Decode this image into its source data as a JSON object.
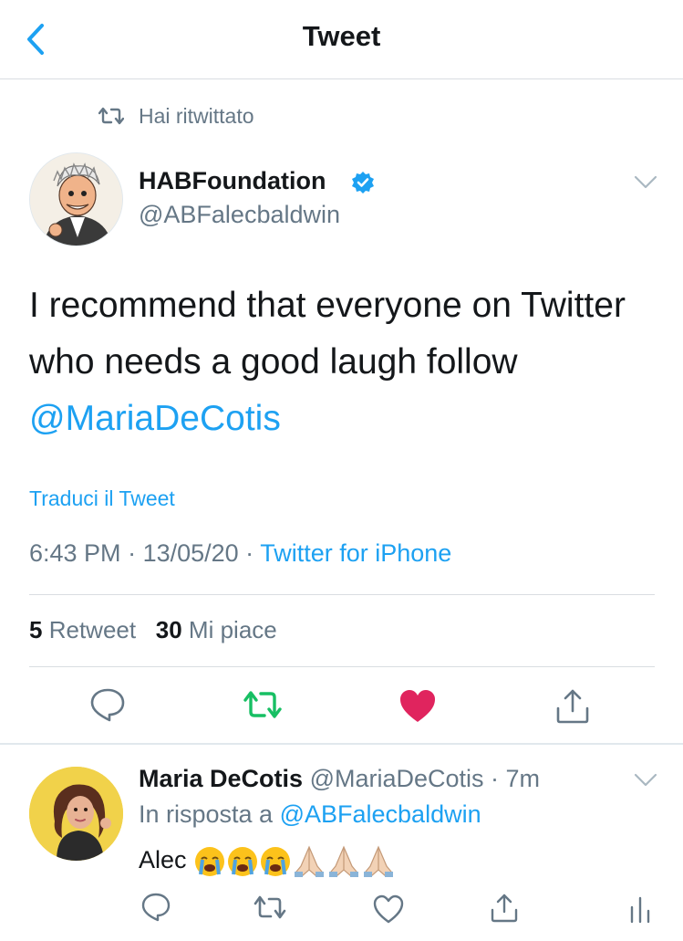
{
  "header": {
    "title": "Tweet",
    "back_icon": "chevron-left-icon"
  },
  "context": {
    "label": "Hai ritwittato",
    "icon": "retweet-icon"
  },
  "tweet": {
    "author_name": "HABFoundation",
    "verified": true,
    "handle": "@ABFalecbaldwin",
    "text_before": "I recommend that everyone on Twitter who needs a good laugh follow ",
    "mention": "@MariaDeCotis",
    "translate_label": "Traduci il Tweet",
    "time": "6:43 PM",
    "date": "13/05/20",
    "source": "Twitter for iPhone",
    "retweets_count": "5",
    "retweets_label": "Retweet",
    "likes_count": "30",
    "likes_label": "Mi piace",
    "liked": true,
    "retweeted": true
  },
  "reply": {
    "author_name": "Maria DeCotis",
    "handle": "@MariaDeCotis",
    "time": "7m",
    "reply_prefix": "In risposta a",
    "reply_to": "@ABFalecbaldwin",
    "text": "Alec",
    "emojis": [
      "loudly-crying-face",
      "loudly-crying-face",
      "loudly-crying-face",
      "folded-hands",
      "folded-hands",
      "folded-hands"
    ]
  },
  "colors": {
    "accent": "#1da1f2",
    "secondary_text": "#657786",
    "retweet_green": "#17bf63",
    "like_red": "#e0245e"
  }
}
